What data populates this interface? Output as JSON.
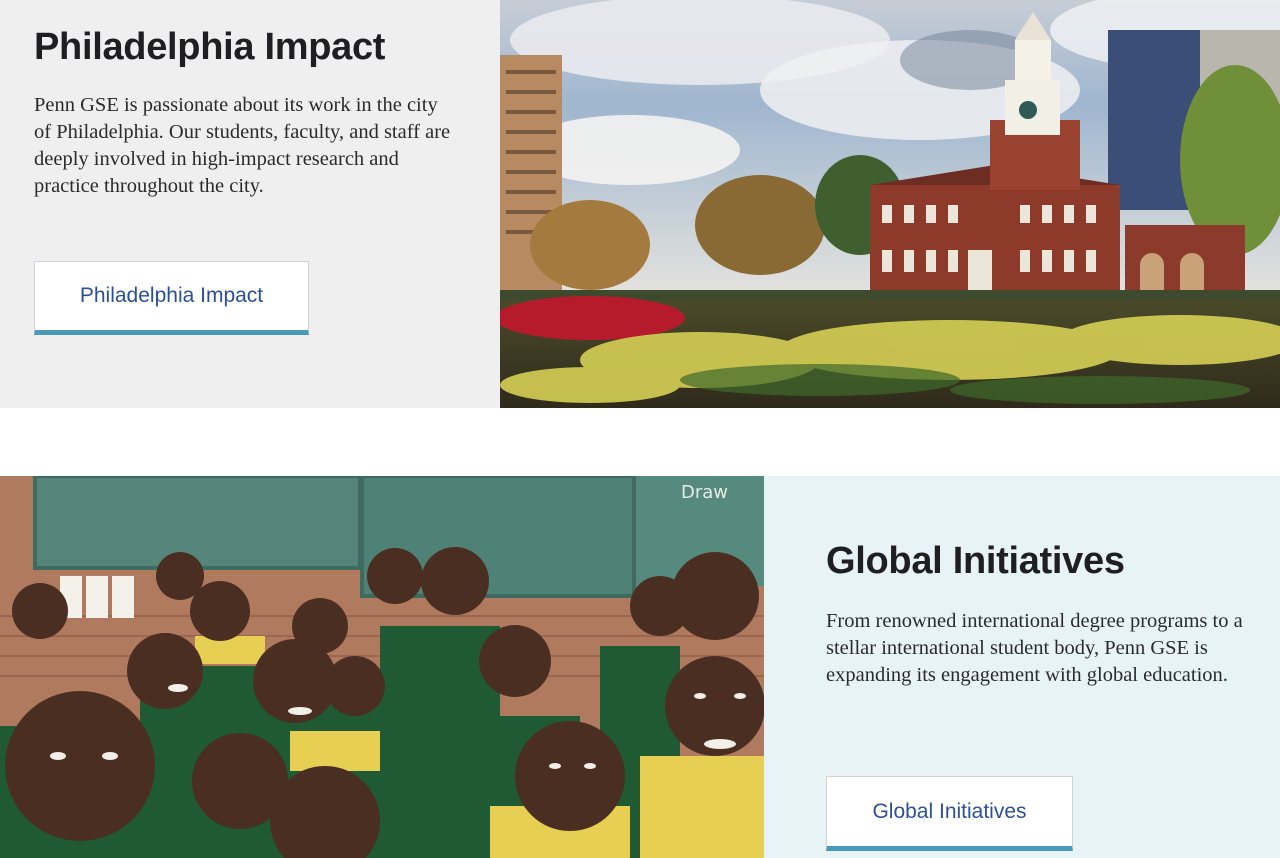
{
  "philadelphia": {
    "title": "Philadelphia Impact",
    "description": "Penn GSE is passionate about its work in the city of Philadelphia. Our students, faculty, and staff are deeply involved in high-impact research and practice throughout the city.",
    "button_label": "Philadelphia Impact",
    "image_icon": "independence-hall-photo"
  },
  "global": {
    "title": "Global Initiatives",
    "description": "From renowned international degree programs to a stellar international student body, Penn GSE is expanding its engagement with global education.",
    "button_label": "Global Initiatives",
    "image_icon": "schoolchildren-photo",
    "chalkboard_text": "Draw"
  },
  "colors": {
    "panel_gray": "#efefef",
    "panel_blue": "#e8f3f6",
    "heading": "#1f1f22",
    "link_blue": "#2c4f9d",
    "button_accent": "#4a9bbb"
  }
}
